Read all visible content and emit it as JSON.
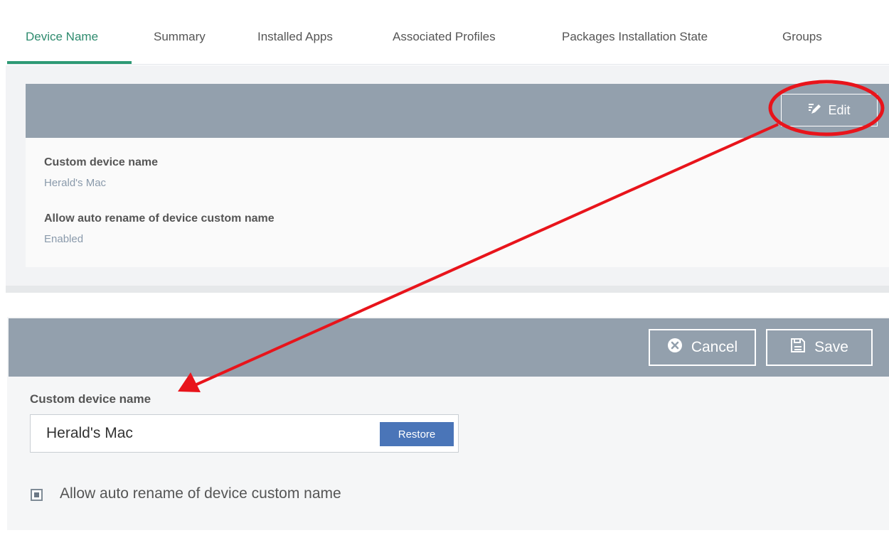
{
  "tabs": [
    {
      "label": "Device Name",
      "active": true
    },
    {
      "label": "Summary"
    },
    {
      "label": "Installed Apps"
    },
    {
      "label": "Associated Profiles"
    },
    {
      "label": "Packages Installation State"
    },
    {
      "label": "Groups"
    }
  ],
  "view_panel": {
    "edit_label": "Edit",
    "fields": [
      {
        "label": "Custom device name",
        "value": "Herald's Mac"
      },
      {
        "label": "Allow auto rename of device custom name",
        "value": "Enabled"
      }
    ]
  },
  "edit_panel": {
    "cancel_label": "Cancel",
    "save_label": "Save",
    "name_label": "Custom device name",
    "name_value": "Herald's Mac",
    "restore_label": "Restore",
    "auto_rename_label": "Allow auto rename of device custom name",
    "auto_rename_checked": true
  },
  "icons": {
    "edit": "edit-pencil-icon",
    "cancel": "cancel-circle-icon",
    "save": "save-floppy-icon"
  },
  "colors": {
    "active_tab": "#2e8b6e",
    "header_bar": "#93a0ad",
    "restore_button": "#4a75b8",
    "annotation": "#e8141b",
    "field_value": "#8a9aab"
  }
}
